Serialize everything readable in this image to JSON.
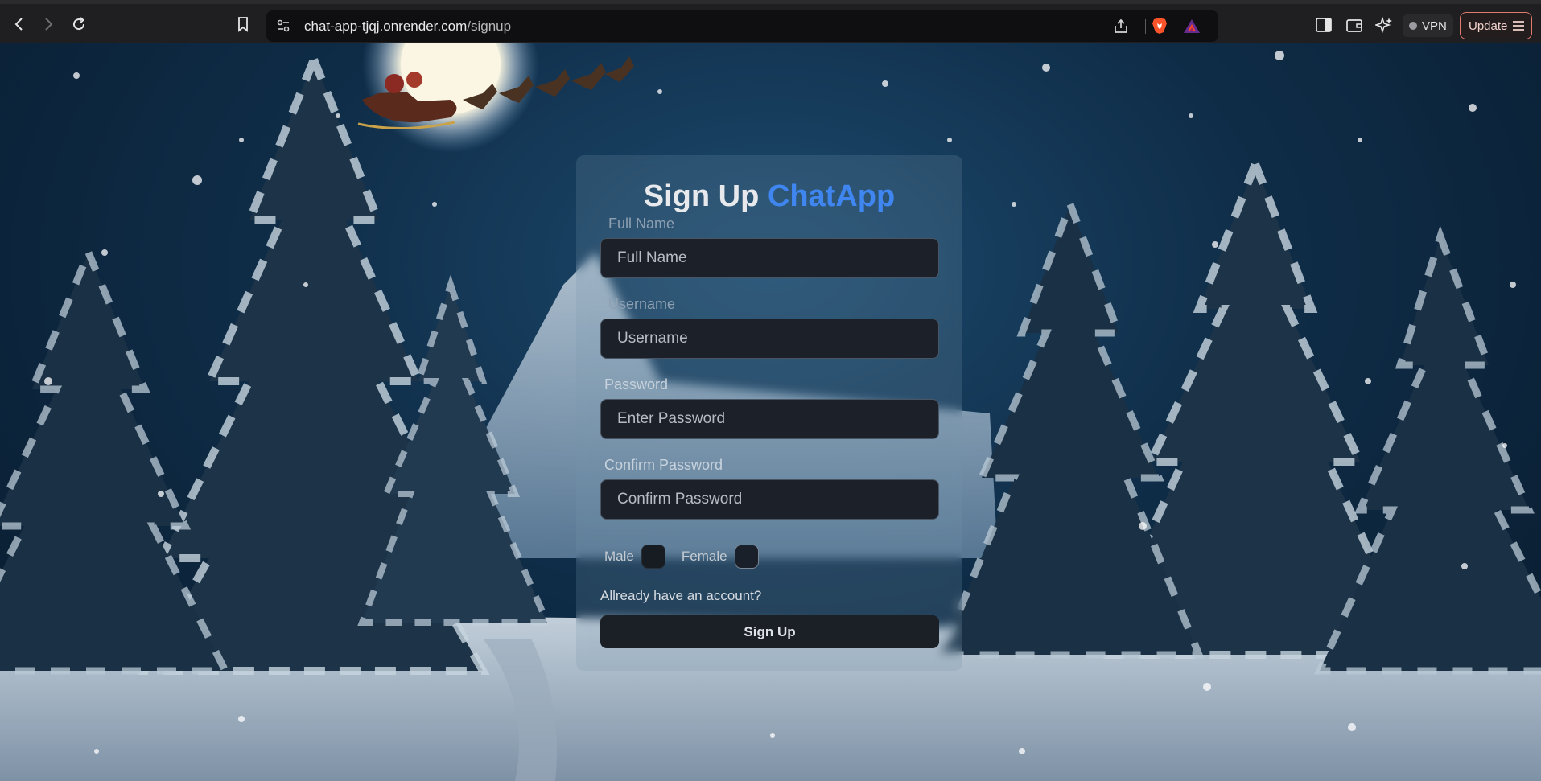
{
  "browser": {
    "url_host": "chat-app-tjqj.onrender.com",
    "url_path": "/signup",
    "vpn_label": "VPN",
    "update_label": "Update"
  },
  "signup": {
    "title_main": "Sign Up",
    "title_accent": "ChatApp",
    "accent_color": "#3f86f0",
    "fields": [
      {
        "label": "Full Name",
        "placeholder": "Full Name"
      },
      {
        "label": "Username",
        "placeholder": "Username"
      },
      {
        "label": "Password",
        "placeholder": "Enter Password"
      },
      {
        "label": "Confirm Password",
        "placeholder": "Confirm Password"
      }
    ],
    "gender_male": "Male",
    "gender_female": "Female",
    "account_link": "Allready have an account?",
    "submit_label": "Sign Up"
  }
}
